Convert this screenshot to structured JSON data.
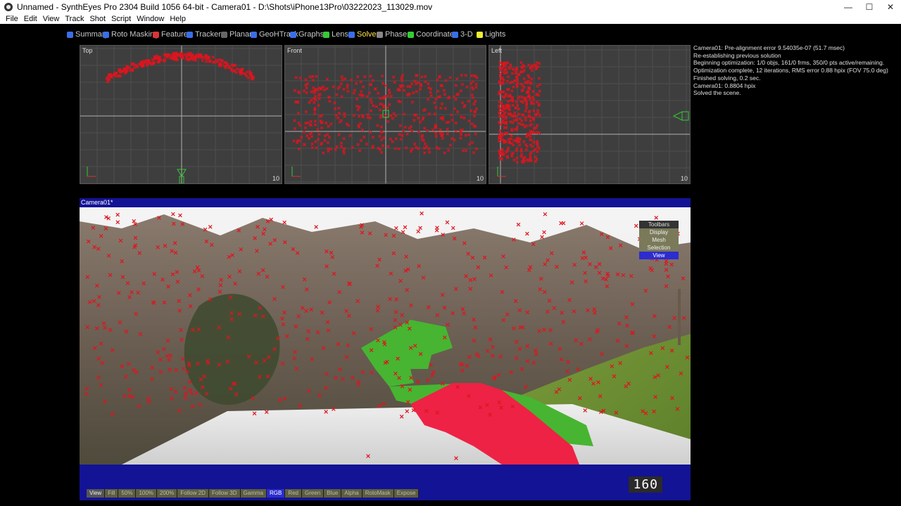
{
  "window": {
    "title": "Unnamed - SynthEyes Pro 2304 Build 1056 64-bit - Camera01 - D:\\Shots\\iPhone13Pro\\03222023_113029.mov",
    "controls": [
      "—",
      "☐",
      "✕"
    ]
  },
  "menu": [
    "File",
    "Edit",
    "View",
    "Track",
    "Shot",
    "Script",
    "Window",
    "Help"
  ],
  "rooms": [
    {
      "label": "Summary",
      "icon": "summary-icon",
      "color": "#3a6ee8"
    },
    {
      "label": "Roto Masking",
      "icon": "roto-icon",
      "color": "#3a6ee8"
    },
    {
      "label": "Features",
      "icon": "features-icon",
      "color": "#d33"
    },
    {
      "label": "Trackers",
      "icon": "trackers-icon",
      "color": "#3a6ee8"
    },
    {
      "label": "Planar",
      "icon": "planar-icon",
      "color": "#666"
    },
    {
      "label": "GeoHTrack",
      "icon": "geohtrack-icon",
      "color": "#3a6ee8"
    },
    {
      "label": "Graphs",
      "icon": "graphs-icon",
      "color": "#3a6ee8"
    },
    {
      "label": "Lens",
      "icon": "lens-icon",
      "color": "#3c3"
    },
    {
      "label": "Solver",
      "icon": "solver-icon",
      "color": "#3a6ee8",
      "active": true
    },
    {
      "label": "Phases",
      "icon": "phases-icon",
      "color": "#888"
    },
    {
      "label": "Coordinates",
      "icon": "coordinates-icon",
      "color": "#3c3"
    },
    {
      "label": "3-D",
      "icon": "3d-icon",
      "color": "#3a6ee8"
    },
    {
      "label": "Lights",
      "icon": "lights-icon",
      "color": "#ee3"
    }
  ],
  "viewports": {
    "top": {
      "label": "Top",
      "number": "10"
    },
    "front": {
      "label": "Front",
      "number": "10"
    },
    "left": {
      "label": "Left",
      "number": "10"
    }
  },
  "log": [
    "Camera01: Pre-alignment error 9.54035e-07 (51.7 msec)",
    "Re-establishing previous solution",
    "Beginning optimization: 1/0 objs, 161/0 frms, 350/0 pts active/remaining.",
    "Optimization complete, 12 iterations, RMS error 0.88 hpix (FOV 75.0 deg)",
    "Finished solving, 0.2 sec.",
    "Camera01: 0.8804 hpix",
    "Solved the scene."
  ],
  "camera_view": {
    "title": "Camera01*",
    "frame": "160",
    "toolbars_panel": [
      "Toolbars",
      "Display",
      "Mesh",
      "Selection",
      "View"
    ],
    "toolbars_active": "View",
    "bottom_buttons": [
      "View",
      "Fill",
      "50%",
      "100%",
      "200%",
      "Follow 2D",
      "Follow 3D",
      "Gamma",
      "RGB",
      "Red",
      "Green",
      "Blue",
      "Alpha",
      "RotoMask",
      "Expose"
    ],
    "bottom_active": [
      "View",
      "RGB"
    ]
  },
  "colors": {
    "tracker": "#e0141e",
    "camera_bg": "#131395",
    "viewport_bg": "#3e3e3e",
    "active_room": "#ffe34a"
  }
}
